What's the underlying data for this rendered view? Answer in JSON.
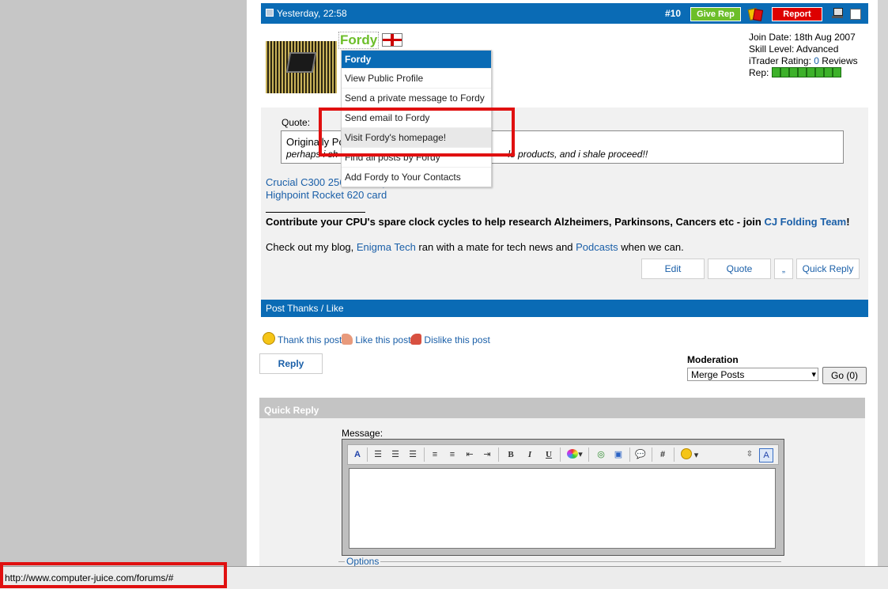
{
  "post": {
    "date": "Yesterday, 22:58",
    "number": "#10",
    "give_rep_label": "Give Rep",
    "report_label": "Report"
  },
  "user": {
    "name": "Fordy",
    "join_date": "Join Date: 18th Aug 2007",
    "skill_level": "Skill Level: Advanced",
    "itrader_prefix": "iTrader Rating: ",
    "itrader_count": "0",
    "itrader_suffix": " Reviews",
    "rep_label": "Rep: ",
    "rep_level": 8
  },
  "user_menu": {
    "header": "Fordy",
    "items": [
      "View Public Profile",
      "Send a private message to Fordy",
      "Send email to Fordy",
      "Visit Fordy's homepage!",
      "Find all posts by Fordy",
      "Add Fordy to Your Contacts"
    ]
  },
  "quote": {
    "label": "Quote:",
    "line1": "Originally Po",
    "line2": "perhaps i sh",
    "line2_end": "le products, and i shale proceed!!"
  },
  "signature": {
    "line1": "Crucial C300 256GB 6Gbps SSD",
    "line2": "Highpoint Rocket 620 card",
    "cta_text": "Contribute your CPU's spare clock cycles to help research Alzheimers, Parkinsons, Cancers etc - join ",
    "cta_link": "CJ Folding Team",
    "cta_end": "!",
    "blog_pre": "Check out my blog, ",
    "blog_link": "Enigma Tech",
    "blog_mid": " ran with a mate for tech news and ",
    "blog_link2": "Podcasts",
    "blog_end": " when we can."
  },
  "post_buttons": {
    "edit": "Edit",
    "quote": "Quote",
    "multiquote": "„",
    "quick_reply": "Quick Reply"
  },
  "thanks": {
    "bar_title": "Post Thanks / Like",
    "thank": "Thank this post",
    "like": "Like this post",
    "dislike": "Dislike this post"
  },
  "reply_label": "Reply",
  "moderation": {
    "label": "Moderation",
    "selected": "Merge Posts",
    "go_label": "Go (0)"
  },
  "quick_reply": {
    "title": "Quick Reply",
    "message_label": "Message:",
    "options_label": "Options"
  },
  "status_bar": {
    "url": "http://www.computer-juice.com/forums/#"
  },
  "colors": {
    "header_blue": "#0a6bb5",
    "give_rep_green": "#6cbe29",
    "report_red": "#dd0000",
    "highlight_red": "#e01010"
  }
}
